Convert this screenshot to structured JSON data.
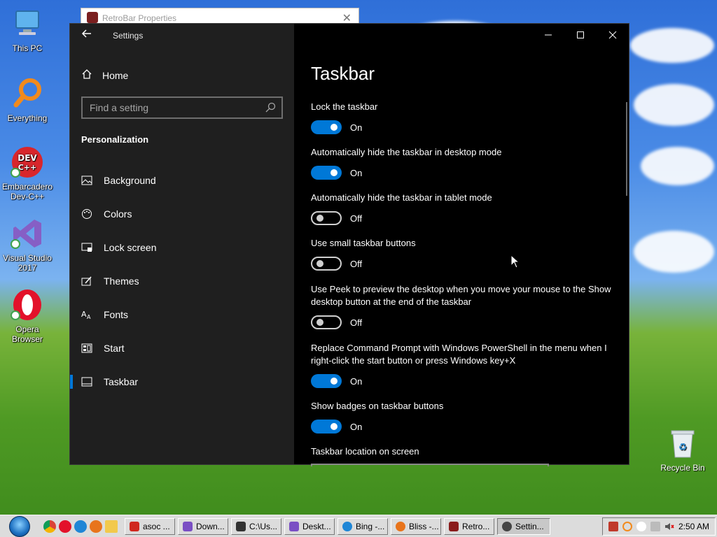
{
  "desktop": {
    "icons": [
      {
        "label": "This PC"
      },
      {
        "label": "Everything"
      },
      {
        "label": "Embarcadero Dev-C++"
      },
      {
        "label": "Visual Studio 2017"
      },
      {
        "label": "Opera Browser"
      },
      {
        "label": "Recycle Bin"
      }
    ]
  },
  "bg_window": {
    "title": "RetroBar Properties"
  },
  "settings": {
    "window_title": "Settings",
    "nav": {
      "home": "Home",
      "search_placeholder": "Find a setting",
      "section": "Personalization",
      "items": [
        {
          "label": "Background",
          "icon": "picture-icon"
        },
        {
          "label": "Colors",
          "icon": "palette-icon"
        },
        {
          "label": "Lock screen",
          "icon": "lock-screen-icon"
        },
        {
          "label": "Themes",
          "icon": "themes-icon"
        },
        {
          "label": "Fonts",
          "icon": "fonts-icon"
        },
        {
          "label": "Start",
          "icon": "start-icon"
        },
        {
          "label": "Taskbar",
          "icon": "taskbar-icon",
          "active": true
        }
      ]
    },
    "page_title": "Taskbar",
    "options": [
      {
        "label": "Lock the taskbar",
        "state": "On"
      },
      {
        "label": "Automatically hide the taskbar in desktop mode",
        "state": "On"
      },
      {
        "label": "Automatically hide the taskbar in tablet mode",
        "state": "Off"
      },
      {
        "label": "Use small taskbar buttons",
        "state": "Off"
      },
      {
        "label": "Use Peek to preview the desktop when you move your mouse to the Show desktop button at the end of the taskbar",
        "state": "Off"
      },
      {
        "label": "Replace Command Prompt with Windows PowerShell in the menu when I right-click the start button or press Windows key+X",
        "state": "On"
      },
      {
        "label": "Show badges on taskbar buttons",
        "state": "On"
      }
    ],
    "location_label": "Taskbar location on screen"
  },
  "taskbar": {
    "buttons": [
      {
        "label": "asoc ...",
        "color": "#d0281e"
      },
      {
        "label": "Down...",
        "color": "#7a4fc4"
      },
      {
        "label": "C:\\Us...",
        "color": "#333333"
      },
      {
        "label": "Deskt...",
        "color": "#7a4fc4"
      },
      {
        "label": "Bing -...",
        "color": "#1f86d6"
      },
      {
        "label": "Bliss -...",
        "color": "#e8741c"
      },
      {
        "label": "Retro...",
        "color": "#8a1c1c"
      },
      {
        "label": "Settin...",
        "color": "#444444",
        "active": true
      }
    ],
    "clock": "2:50 AM"
  }
}
